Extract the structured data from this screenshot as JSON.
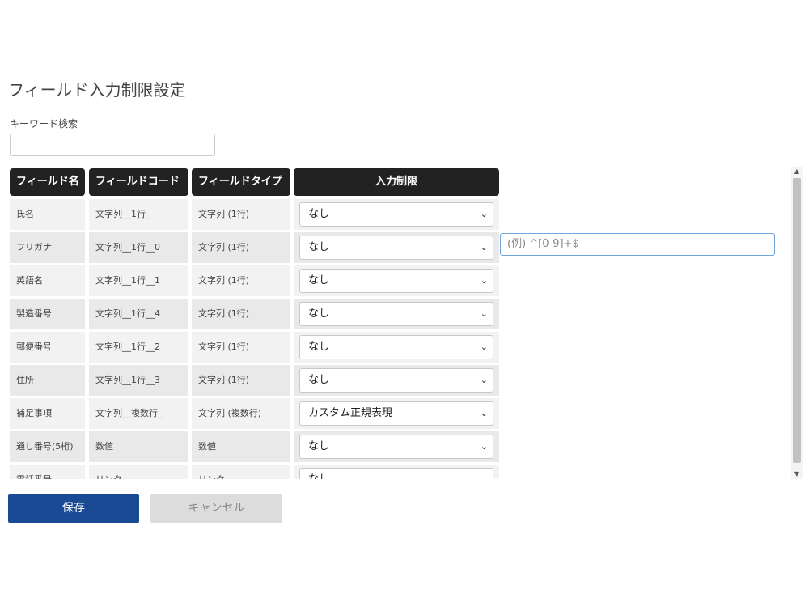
{
  "page": {
    "title": "フィールド入力制限設定",
    "search_label": "キーワード検索",
    "search_value": ""
  },
  "table": {
    "headers": [
      "フィールド名",
      "フィールドコード",
      "フィールドタイプ",
      "入力制限"
    ],
    "rows": [
      {
        "name": "氏名",
        "code": "文字列__1行_",
        "type": "文字列 (1行)",
        "restriction": "なし"
      },
      {
        "name": "フリガナ",
        "code": "文字列__1行__0",
        "type": "文字列 (1行)",
        "restriction": "なし"
      },
      {
        "name": "英語名",
        "code": "文字列__1行__1",
        "type": "文字列 (1行)",
        "restriction": "なし"
      },
      {
        "name": "製造番号",
        "code": "文字列__1行__4",
        "type": "文字列 (1行)",
        "restriction": "なし"
      },
      {
        "name": "郵便番号",
        "code": "文字列__1行__2",
        "type": "文字列 (1行)",
        "restriction": "なし"
      },
      {
        "name": "住所",
        "code": "文字列__1行__3",
        "type": "文字列 (1行)",
        "restriction": "なし"
      },
      {
        "name": "補足事項",
        "code": "文字列__複数行_",
        "type": "文字列 (複数行)",
        "restriction": "カスタム正規表現"
      },
      {
        "name": "通し番号(5桁)",
        "code": "数値",
        "type": "数値",
        "restriction": "なし"
      },
      {
        "name": "電話番号",
        "code": "リンク",
        "type": "リンク",
        "restriction": "なし"
      }
    ],
    "regex_placeholder": "(例) ^[0-9]+$"
  },
  "buttons": {
    "save": "保存",
    "cancel": "キャンセル"
  },
  "colors": {
    "header_bg": "#222222",
    "save_bg": "#1a4a93",
    "cancel_bg": "#dcdcdc",
    "focus_border": "#6ea6d9"
  }
}
